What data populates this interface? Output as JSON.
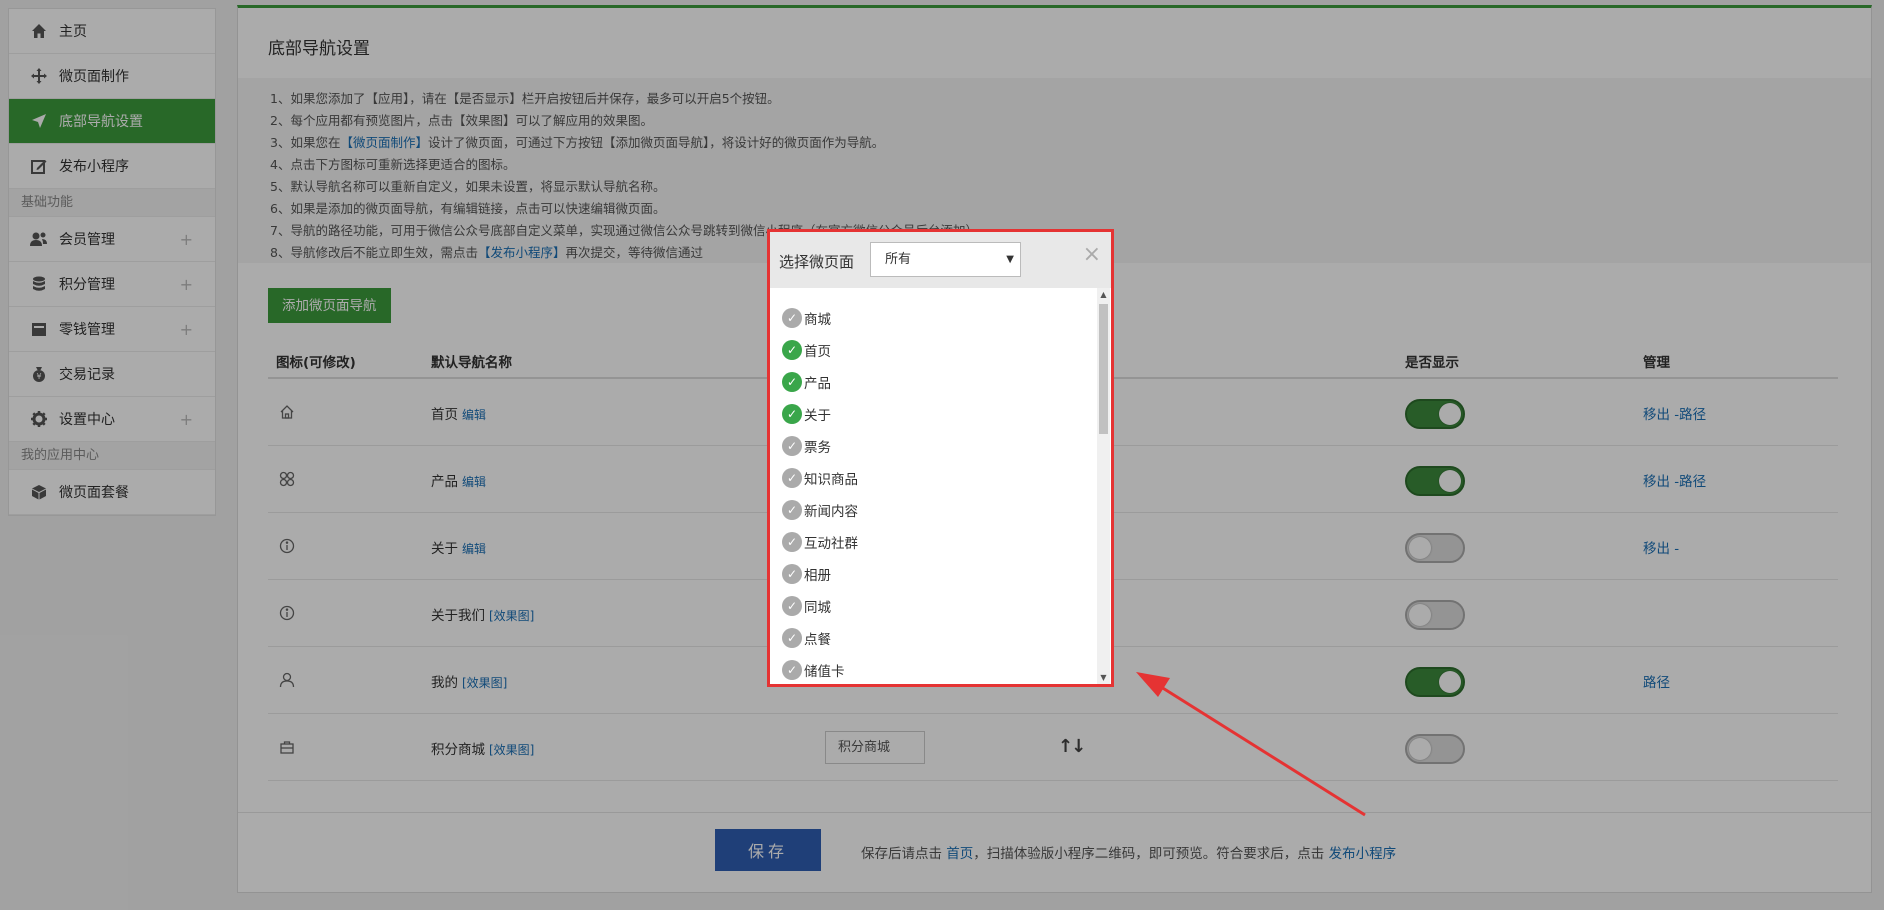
{
  "sidebar": {
    "items": [
      {
        "label": "主页",
        "icon": "home-icon"
      },
      {
        "label": "微页面制作",
        "icon": "move-icon"
      },
      {
        "label": "底部导航设置",
        "icon": "navigation-arrow-icon"
      },
      {
        "label": "发布小程序",
        "icon": "edit-icon"
      }
    ],
    "group_basic": "基础功能",
    "basic_items": [
      {
        "label": "会员管理",
        "icon": "users-icon"
      },
      {
        "label": "积分管理",
        "icon": "database-icon"
      },
      {
        "label": "零钱管理",
        "icon": "wallet-icon"
      },
      {
        "label": "交易记录",
        "icon": "money-bag-icon"
      },
      {
        "label": "设置中心",
        "icon": "gear-icon"
      }
    ],
    "group_apps": "我的应用中心",
    "app_items": [
      {
        "label": "微页面套餐",
        "icon": "cube-icon"
      }
    ],
    "plus": "+"
  },
  "main": {
    "title": "底部导航设置",
    "notes": [
      "1、如果您添加了【应用】，请在【是否显示】栏开启按钮后并保存，最多可以开启5个按钮。",
      "2、每个应用都有预览图片，点击【效果图】可以了解应用的效果图。",
      "3、如果您在",
      "【微页面制作】",
      "设计了微页面，可通过下方按钮【添加微页面导航】，将设计好的微页面作为导航。",
      "4、点击下方图标可重新选择更适合的图标。",
      "5、默认导航名称可以重新自定义，如果未设置，将显示默认导航名称。",
      "6、如果是添加的微页面导航，有编辑链接，点击可以快速编辑微页面。",
      "7、导航的路径功能，可用于微信公众号底部自定义菜单，实现通过微信公众号跳转到微信小程序（在官方微信公众号后台添加）",
      "8、导航修改后不能立即生效，需点击",
      "【发布小程序】",
      "再次提交，等待微信通过"
    ],
    "add_button": "添加微页面导航",
    "table": {
      "headers": [
        "图标(可修改)",
        "默认导航名称",
        "是否显示",
        "管理"
      ],
      "rows": [
        {
          "icon": "house-icon",
          "name": "首页",
          "link": "编辑",
          "input": "",
          "arrows": "",
          "show": true,
          "manage": "移出 -路径"
        },
        {
          "icon": "grid-icon",
          "name": "产品",
          "link": "编辑",
          "input": "",
          "arrows": "",
          "show": true,
          "manage": "移出 -路径"
        },
        {
          "icon": "info-icon",
          "name": "关于",
          "link": "编辑",
          "input": "",
          "arrows": "",
          "show": false,
          "manage": "移出 -"
        },
        {
          "icon": "info-icon",
          "name": "关于我们",
          "link": "[效果图]",
          "input": "",
          "arrows": "",
          "show": false,
          "manage": ""
        },
        {
          "icon": "person-icon",
          "name": "我的",
          "link": "[效果图]",
          "input": "",
          "arrows": "",
          "show": true,
          "manage": "路径"
        },
        {
          "icon": "shop-icon",
          "name": "积分商城",
          "link": "[效果图]",
          "input": "积分商城",
          "arrows": "↑↓",
          "show": false,
          "manage": ""
        }
      ]
    },
    "save_button": "保存",
    "footer_text_1": "保存后请点击 ",
    "footer_link_1": "首页",
    "footer_text_2": "，扫描体验版小程序二维码，即可预览。符合要求后，点击 ",
    "footer_link_2": "发布小程序"
  },
  "modal": {
    "title": "选择微页面",
    "select_value": "所有",
    "close": "×",
    "items": [
      {
        "label": "商城",
        "checked": false
      },
      {
        "label": "首页",
        "checked": true
      },
      {
        "label": "产品",
        "checked": true
      },
      {
        "label": "关于",
        "checked": true
      },
      {
        "label": "票务",
        "checked": false
      },
      {
        "label": "知识商品",
        "checked": false
      },
      {
        "label": "新闻内容",
        "checked": false
      },
      {
        "label": "互动社群",
        "checked": false
      },
      {
        "label": "相册",
        "checked": false
      },
      {
        "label": "同城",
        "checked": false
      },
      {
        "label": "点餐",
        "checked": false
      },
      {
        "label": "储值卡",
        "checked": false
      }
    ],
    "check_glyph": "✓",
    "scroll_up": "▲",
    "scroll_down": "▼"
  },
  "colors": {
    "accent_green": "#3d9b3d",
    "link_blue": "#1a6fb5",
    "highlight_red": "#e53333",
    "save_blue": "#2f5fb3"
  }
}
